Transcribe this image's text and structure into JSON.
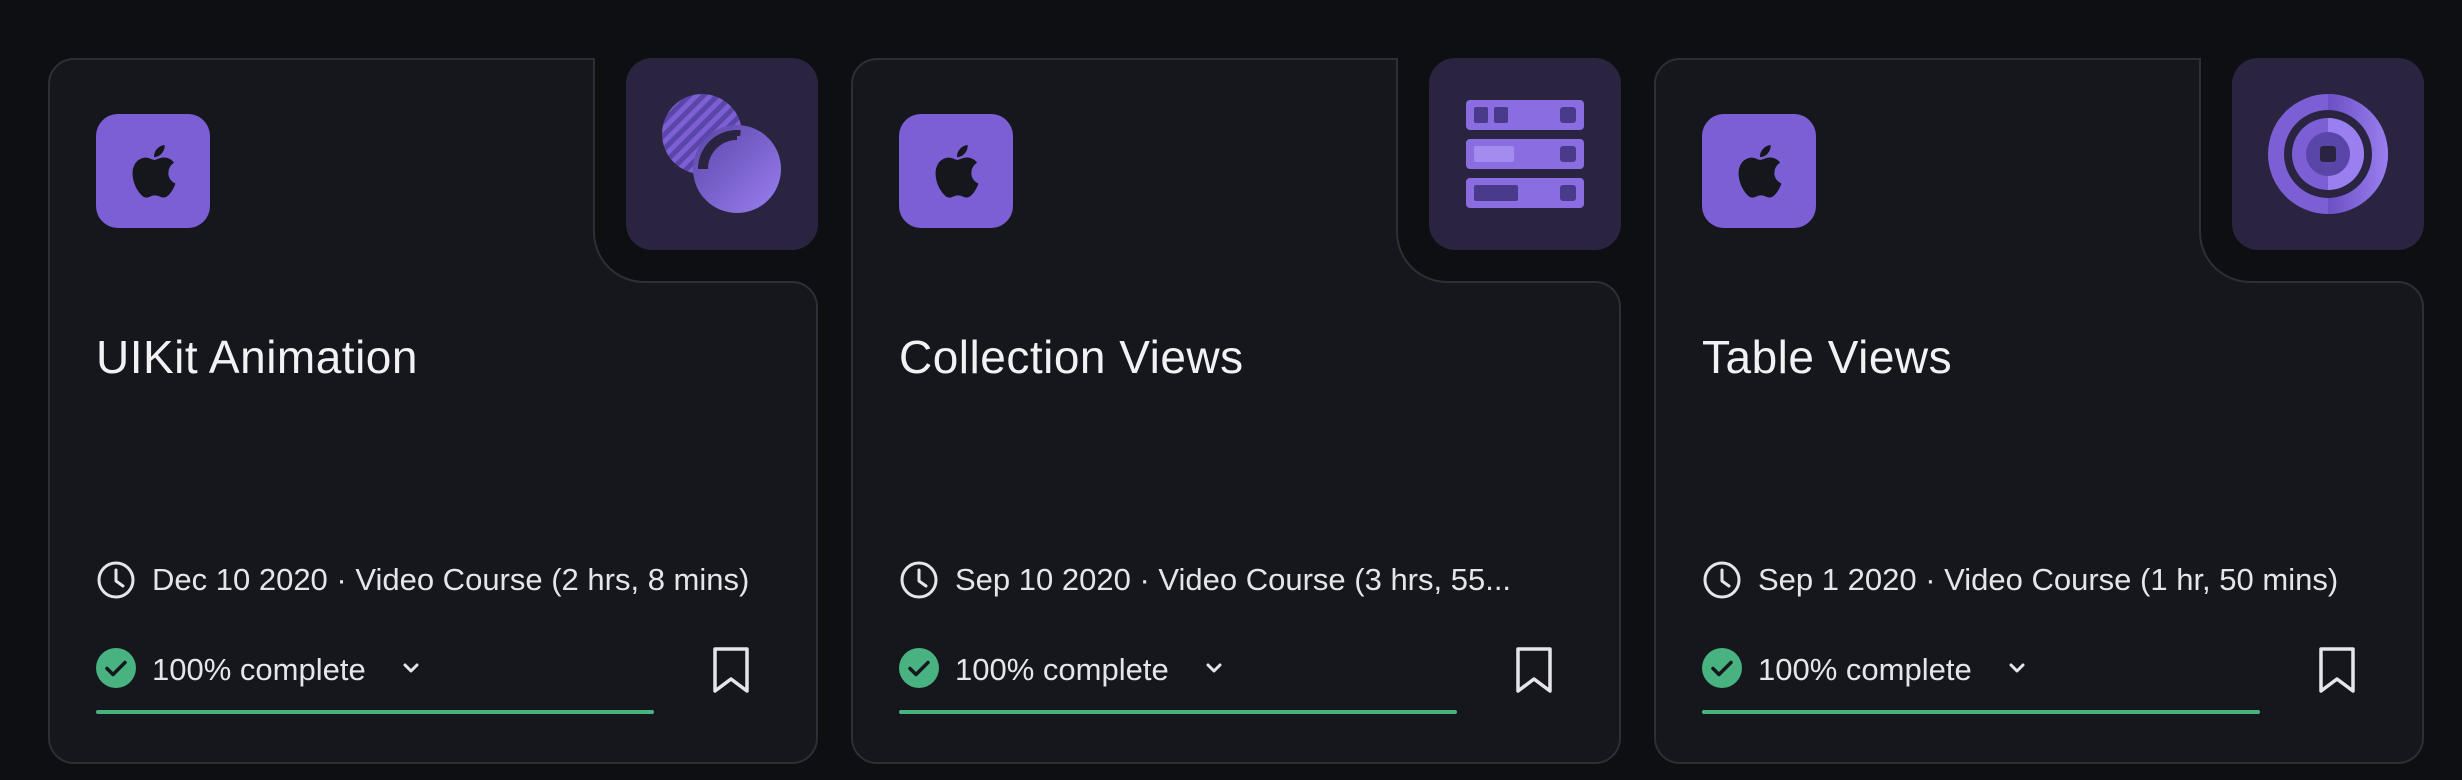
{
  "colors": {
    "background": "#0e0f13",
    "card": "#15171c",
    "accent_purple": "#7c5fd4",
    "thumbnail_bg": "#2a2440",
    "success_green": "#48b380"
  },
  "cards": [
    {
      "platform_icon": "apple-icon",
      "thumbnail_icon": "overlapping-circles-icon",
      "title": "UIKit Animation",
      "meta": "Dec 10 2020 · Video Course (2 hrs, 8 mins)",
      "progress_label": "100% complete",
      "progress": 1.0,
      "bookmark_icon": "bookmark-icon"
    },
    {
      "platform_icon": "apple-icon",
      "thumbnail_icon": "stacked-rows-icon",
      "title": "Collection Views",
      "meta": "Sep 10 2020 · Video Course (3 hrs, 55...",
      "progress_label": "100% complete",
      "progress": 1.0,
      "bookmark_icon": "bookmark-icon"
    },
    {
      "platform_icon": "apple-icon",
      "thumbnail_icon": "target-ring-icon",
      "title": "Table Views",
      "meta": "Sep 1 2020 · Video Course (1 hr, 50 mins)",
      "progress_label": "100% complete",
      "progress": 1.0,
      "bookmark_icon": "bookmark-icon"
    }
  ]
}
